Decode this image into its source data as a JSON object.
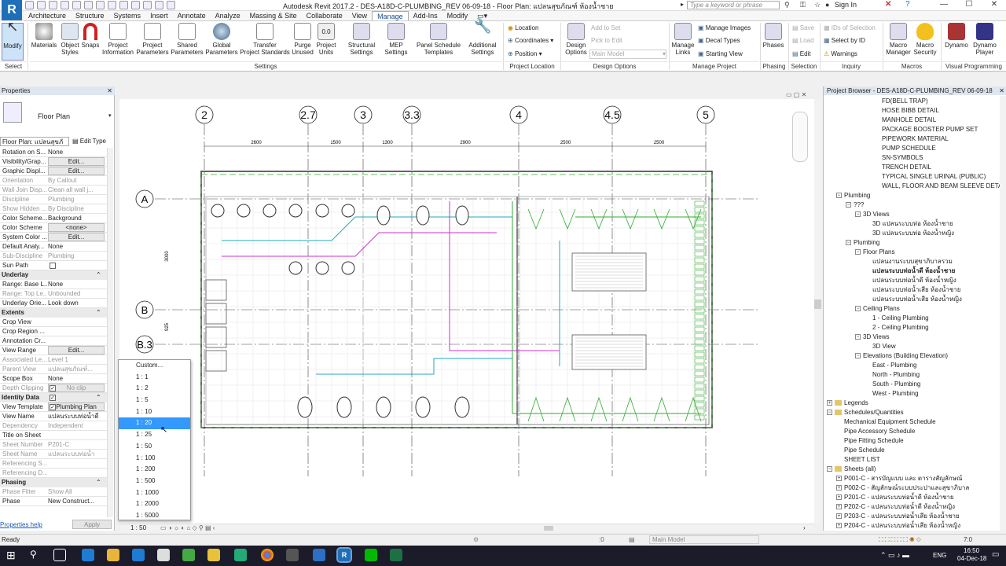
{
  "app": {
    "logo": "R",
    "title": "Autodesk Revit 2017.2 -    DES-A18D-C-PLUMBING_REV 06-09-18 - Floor Plan: แปลนสุขภัณฑ์ ห้องน้ำชาย",
    "search_placeholder": "Type a keyword or phrase",
    "sign_in": "Sign In"
  },
  "tabs": [
    "Architecture",
    "Structure",
    "Systems",
    "Insert",
    "Annotate",
    "Analyze",
    "Massing & Site",
    "Collaborate",
    "View",
    "Manage",
    "Add-Ins",
    "Modify"
  ],
  "active_tab": "Manage",
  "ribbon": {
    "select_panel": "Select",
    "modify": "Modify",
    "buttons": [
      {
        "label": "Materials"
      },
      {
        "label": "Object\nStyles"
      },
      {
        "label": "Snaps"
      },
      {
        "label": "Project\nInformation"
      },
      {
        "label": "Project\nParameters"
      },
      {
        "label": "Shared\nParameters"
      },
      {
        "label": "Global\nParameters"
      },
      {
        "label": "Transfer\nProject Standards"
      },
      {
        "label": "Purge\nUnused"
      },
      {
        "label": "Project\nUnits"
      },
      {
        "label": "Structural\nSettings"
      },
      {
        "label": "MEP\nSettings"
      },
      {
        "label": "Panel Schedule\nTemplates"
      },
      {
        "label": "Additional\nSettings"
      }
    ],
    "settings_panel": "Settings",
    "location": "Location",
    "coordinates": "Coordinates",
    "position": "Position",
    "project_location_panel": "Project Location",
    "design_options": "Design\nOptions",
    "add_to_set": "Add to Set",
    "pick_to_edit": "Pick to Edit",
    "main_model": "Main Model",
    "design_options_panel": "Design Options",
    "manage_links": "Manage\nLinks",
    "manage_images": "Manage Images",
    "decal_types": "Decal Types",
    "starting_view": "Starting View",
    "manage_project_panel": "Manage Project",
    "phases": "Phases",
    "phasing_panel": "Phasing",
    "save": "Save",
    "load": "Load",
    "edit": "Edit",
    "ids_of_selection": "IDs of Selection",
    "select_by_id": "Select by ID",
    "warnings": "Warnings",
    "selection_panel": "Selection",
    "inquiry_panel": "Inquiry",
    "macro_manager": "Macro\nManager",
    "macro_security": "Macro\nSecurity",
    "macros_panel": "Macros",
    "dynamo": "Dynamo",
    "dynamo_player": "Dynamo\nPlayer",
    "visual_programming_panel": "Visual Programming"
  },
  "properties": {
    "title": "Properties",
    "type_name": "Floor Plan",
    "instance_selector": "Floor Plan: แปลนสุขภั",
    "edit_type": "Edit Type",
    "rows": [
      {
        "k": "Rotation on S...",
        "v": "None"
      },
      {
        "k": "Visibility/Grap...",
        "v": "Edit...",
        "btn": true
      },
      {
        "k": "Graphic Displ...",
        "v": "Edit...",
        "btn": true
      },
      {
        "k": "Orientation",
        "v": "By Callout",
        "dim": true
      },
      {
        "k": "Wall Join Disp...",
        "v": "Clean all wall j...",
        "dim": true
      },
      {
        "k": "Discipline",
        "v": "Plumbing",
        "dim": true
      },
      {
        "k": "Show Hidden ...",
        "v": "By Discipline",
        "dim": true
      },
      {
        "k": "Color Scheme...",
        "v": "Background"
      },
      {
        "k": "Color Scheme",
        "v": "<none>",
        "btn": true
      },
      {
        "k": "System Color ...",
        "v": "Edit...",
        "btn": true
      },
      {
        "k": "Default Analy...",
        "v": "None"
      },
      {
        "k": "Sub-Discipline",
        "v": "Plumbing",
        "dim": true
      },
      {
        "k": "Sun Path",
        "v": ""
      }
    ],
    "underlay_header": "Underlay",
    "underlay_rows": [
      {
        "k": "Range: Base L...",
        "v": "None"
      },
      {
        "k": "Range: Top Le...",
        "v": "Unbounded",
        "dim": true
      },
      {
        "k": "Underlay Orie...",
        "v": "Look down"
      }
    ],
    "extents_header": "Extents",
    "extents_rows": [
      {
        "k": "Crop View",
        "v": ""
      },
      {
        "k": "Crop Region ...",
        "v": ""
      },
      {
        "k": "Annotation Cr...",
        "v": ""
      },
      {
        "k": "View Range",
        "v": "Edit...",
        "btn": true
      },
      {
        "k": "Associated Le...",
        "v": "Level 1",
        "dim": true
      },
      {
        "k": "Parent View",
        "v": "แปลนสุขภัณฑ์...",
        "dim": true
      },
      {
        "k": "Scope Box",
        "v": "None"
      },
      {
        "k": "Depth Clipping",
        "v": "No clip",
        "btn": true,
        "dim": true
      }
    ],
    "identity_header": "Identity Data",
    "identity_rows": [
      {
        "k": "View Template",
        "v": "Plumbing Plan",
        "btn": true
      },
      {
        "k": "View Name",
        "v": "แปลนระบบท่อน้ำดี"
      },
      {
        "k": "Dependency",
        "v": "Independent",
        "dim": true
      },
      {
        "k": "Title on Sheet",
        "v": ""
      },
      {
        "k": "Sheet Number",
        "v": "P201-C",
        "dim": true
      },
      {
        "k": "Sheet Name",
        "v": "แปลนระบบท่อน้ำ",
        "dim": true
      },
      {
        "k": "Referencing S...",
        "v": "",
        "dim": true
      },
      {
        "k": "Referencing D...",
        "v": "",
        "dim": true
      }
    ],
    "phasing_header": "Phasing",
    "phasing_rows": [
      {
        "k": "Phase Filter",
        "v": "Show All",
        "dim": true
      },
      {
        "k": "Phase",
        "v": "New Construct..."
      }
    ],
    "help_link": "Properties help",
    "apply": "Apply"
  },
  "scale_menu": {
    "options": [
      "Custom...",
      "1 : 1",
      "1 : 2",
      "1 : 5",
      "1 : 10",
      "1 : 20",
      "1 : 25",
      "1 : 50",
      "1 : 100",
      "1 : 200",
      "1 : 500",
      "1 : 1000",
      "1 : 2000",
      "1 : 5000"
    ],
    "selected": "1 : 20",
    "current_scale": "1 : 50"
  },
  "drawing": {
    "grids_top": [
      "2",
      "2.7",
      "3",
      "3.3",
      "4",
      "4.5",
      "5"
    ],
    "grids_left": [
      "A",
      "B",
      "B.3"
    ],
    "dims": [
      "2600",
      "1500",
      "1300",
      "2900",
      "2500",
      "2500"
    ],
    "dim_vertical": [
      "3000",
      "925"
    ]
  },
  "browser": {
    "title": "Project Browser - DES-A18D-C-PLUMBING_REV 06-09-18",
    "rows": [
      {
        "t": "FD(BELL TRAP)",
        "i": 5
      },
      {
        "t": "HOSE BIBB DETAIL",
        "i": 5
      },
      {
        "t": "MANHOLE  DETAIL",
        "i": 5
      },
      {
        "t": "PACKAGE BOOSTER PUMP SET",
        "i": 5
      },
      {
        "t": "PIPEWORK MATERIAL",
        "i": 5
      },
      {
        "t": "PUMP SCHEDULE",
        "i": 5
      },
      {
        "t": "SN-SYMBOLS",
        "i": 5
      },
      {
        "t": "TRENCH DETAIL",
        "i": 5
      },
      {
        "t": "TYPICAL SINGLE URINAL (PUBLIC)",
        "i": 5
      },
      {
        "t": "WALL, FLOOR AND BEAM SLEEVE DETAIL",
        "i": 5
      },
      {
        "t": "Plumbing",
        "i": 1,
        "tw": "−"
      },
      {
        "t": "???",
        "i": 2,
        "tw": "−"
      },
      {
        "t": "3D Views",
        "i": 3,
        "tw": "−"
      },
      {
        "t": "3D แปลนระบบท่อ ห้องน้ำชาย",
        "i": 4
      },
      {
        "t": "3D แปลนระบบท่อ ห้องน้ำหญิง",
        "i": 4
      },
      {
        "t": "Plumbing",
        "i": 2,
        "tw": "−"
      },
      {
        "t": "Floor Plans",
        "i": 3,
        "tw": "−"
      },
      {
        "t": "แปลนงานระบบสุขาภิบาลรวม",
        "i": 4
      },
      {
        "t": "แปลนระบบท่อน้ำดี ห้องน้ำชาย",
        "i": 4,
        "bold": true
      },
      {
        "t": "แปลนระบบท่อน้ำดี ห้องน้ำหญิง",
        "i": 4
      },
      {
        "t": "แปลนระบบท่อน้ำเสีย ห้องน้ำชาย",
        "i": 4
      },
      {
        "t": "แปลนระบบท่อน้ำเสีย ห้องน้ำหญิง",
        "i": 4
      },
      {
        "t": "Ceiling Plans",
        "i": 3,
        "tw": "−"
      },
      {
        "t": "1 - Ceiling Plumbing",
        "i": 4
      },
      {
        "t": "2 - Ceiling Plumbing",
        "i": 4
      },
      {
        "t": "3D Views",
        "i": 3,
        "tw": "−"
      },
      {
        "t": "3D View",
        "i": 4
      },
      {
        "t": "Elevations (Building Elevation)",
        "i": 3,
        "tw": "−"
      },
      {
        "t": "East - Plumbing",
        "i": 4
      },
      {
        "t": "North - Plumbing",
        "i": 4
      },
      {
        "t": "South - Plumbing",
        "i": 4
      },
      {
        "t": "West - Plumbing",
        "i": 4
      },
      {
        "t": "Legends",
        "i": 0,
        "tw": "+"
      },
      {
        "t": "Schedules/Quantities",
        "i": 0,
        "tw": "−"
      },
      {
        "t": "Mechanical Equipment Schedule",
        "i": 1
      },
      {
        "t": "Pipe Accessory Schedule",
        "i": 1
      },
      {
        "t": "Pipe Fitting Schedule",
        "i": 1
      },
      {
        "t": "Pipe Schedule",
        "i": 1
      },
      {
        "t": "SHEET LIST",
        "i": 1
      },
      {
        "t": "Sheets (all)",
        "i": 0,
        "tw": "−"
      },
      {
        "t": "P001-C - สารบัญแบบ และ ตารางสัญลักษณ์",
        "i": 1,
        "tw": "+"
      },
      {
        "t": "P002-C - สัญลักษณ์ระบบประปาและสุขาภิบาล",
        "i": 1,
        "tw": "+"
      },
      {
        "t": "P201-C - แปลนระบบท่อน้ำดี ห้องน้ำชาย",
        "i": 1,
        "tw": "+"
      },
      {
        "t": "P202-C - แปลนระบบท่อน้ำดี ห้องน้ำหญิง",
        "i": 1,
        "tw": "+"
      },
      {
        "t": "P203-C - แปลนระบบท่อน้ำเสีย ห้องน้ำชาย",
        "i": 1,
        "tw": "+"
      },
      {
        "t": "P204-C - แปลนระบบท่อน้ำเสีย ห้องน้ำหญิง",
        "i": 1,
        "tw": "+"
      }
    ]
  },
  "status": {
    "ready": "Ready",
    "selection_count": ":0",
    "main_model": "Main Model",
    "filter_count": "7:0"
  },
  "taskbar": {
    "lang": "ENG",
    "time": "16:50",
    "date": "04-Dec-18"
  },
  "colors": {
    "accent": "#1f6fb8",
    "selected": "#3399ff",
    "panel_head": "#dfe6ef"
  }
}
